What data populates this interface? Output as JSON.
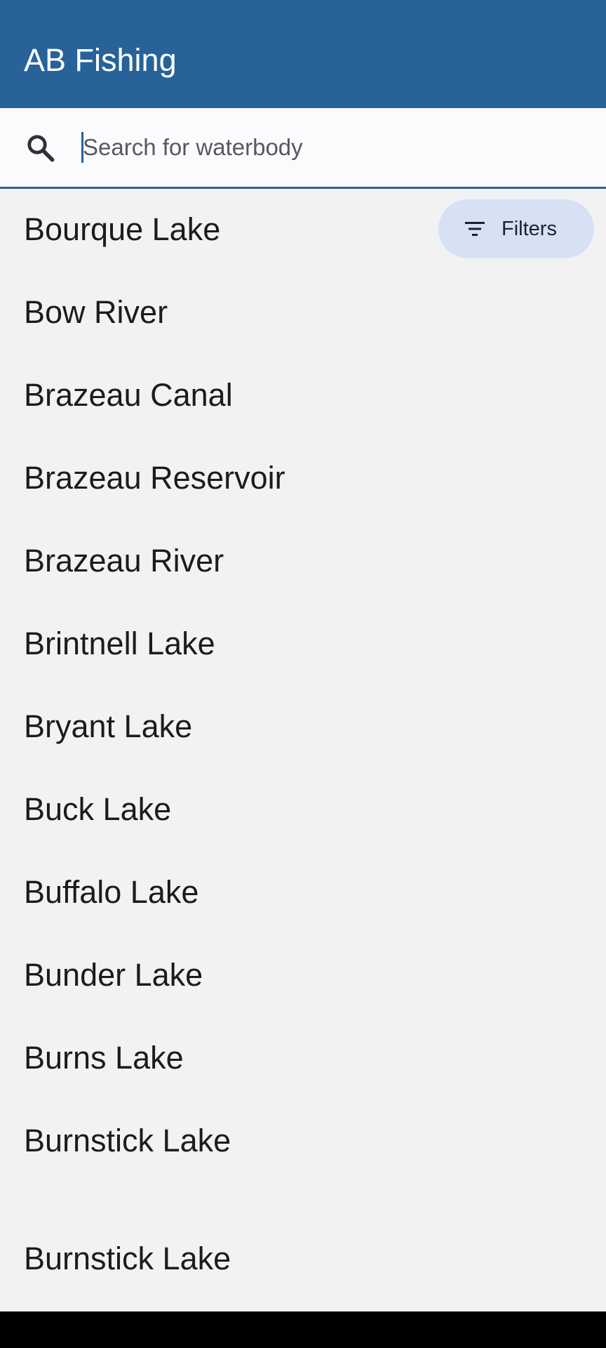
{
  "app_bar": {
    "title": "AB Fishing"
  },
  "search": {
    "placeholder": "Search for waterbody",
    "value": "",
    "icon": "search-icon"
  },
  "filters": {
    "label": "Filters",
    "icon": "filter-list-icon"
  },
  "waterbodies": [
    "Bourque Lake",
    "Bow River",
    "Brazeau Canal",
    "Brazeau Reservoir",
    "Brazeau River",
    "Brintnell Lake",
    "Bryant Lake",
    "Buck Lake",
    "Buffalo Lake",
    "Bunder Lake",
    "Burns Lake",
    "Burnstick Lake",
    "Burnstick Lake"
  ],
  "colors": {
    "primary": "#276398",
    "app_background": "#f2f2f2",
    "search_background": "#fbfbfe",
    "filters_chip_background": "#d6e2f4",
    "navigation_bar": "#000000"
  }
}
